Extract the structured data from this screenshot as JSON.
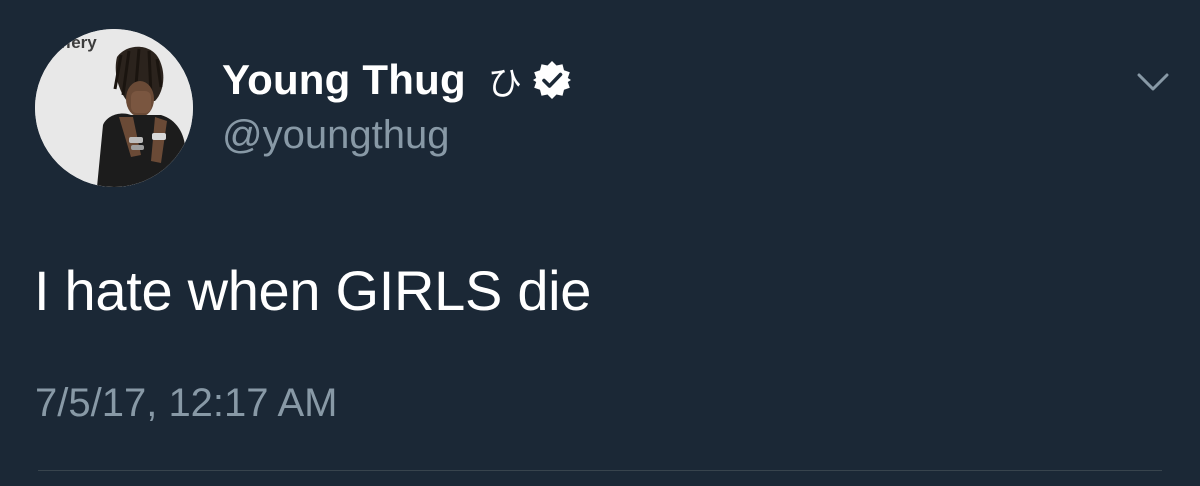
{
  "author": {
    "display_name": "Young Thug",
    "name_emoji": "ひ",
    "verified_icon": "verified-badge-icon",
    "handle": "@youngthug",
    "avatar_overlay_text": "Jeffery"
  },
  "tweet": {
    "text": "I hate when GIRLS die",
    "timestamp": "7/5/17, 12:17 AM"
  },
  "menu": {
    "icon": "chevron-down-icon"
  },
  "colors": {
    "background": "#1b2836",
    "primary_text": "#ffffff",
    "secondary_text": "#8899a6",
    "divider": "#38444d"
  }
}
